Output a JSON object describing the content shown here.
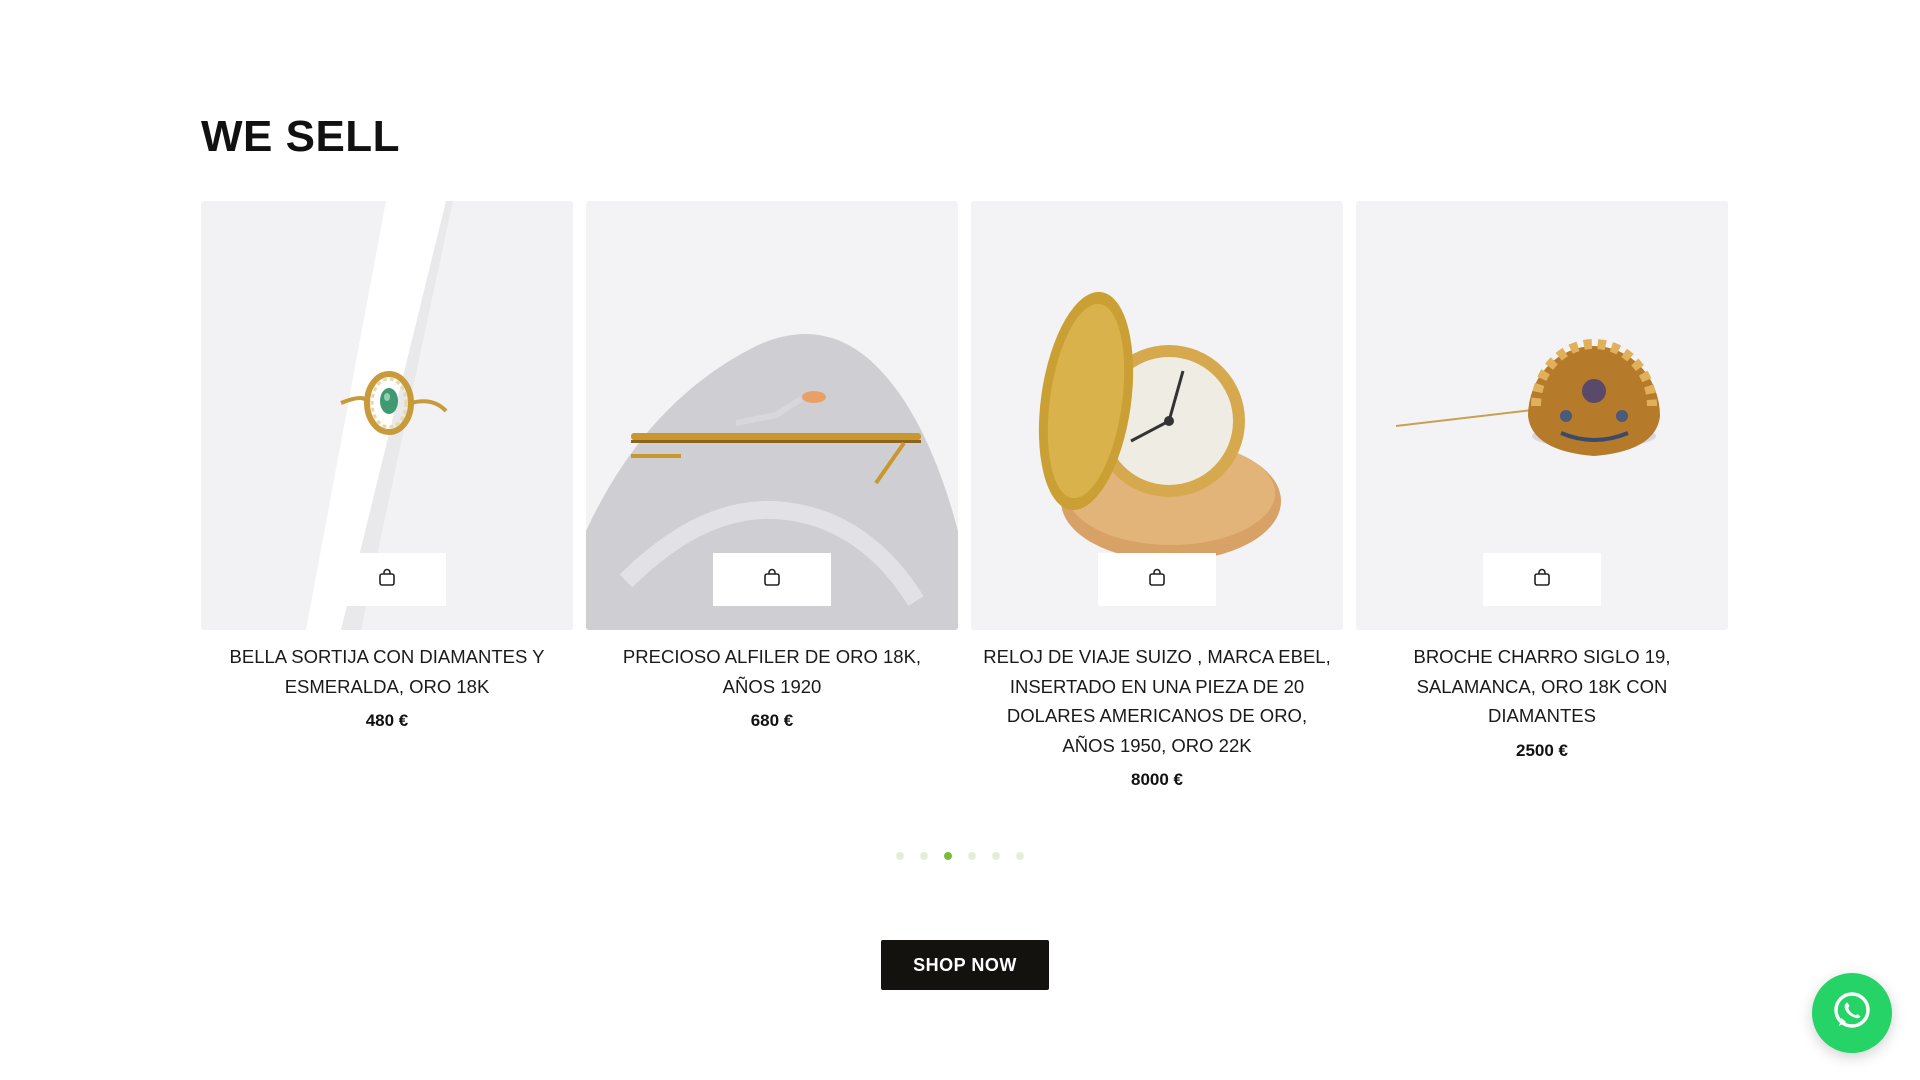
{
  "section": {
    "title": "WE SELL"
  },
  "products": [
    {
      "title": "BELLA SORTIJA CON DIAMANTES Y ESMERALDA, ORO 18K",
      "price": "480 €",
      "image": "emerald-ring-on-cone"
    },
    {
      "title": "PRECIOSO ALFILER DE ORO 18K, AÑOS 1920",
      "price": "680 €",
      "image": "gold-bar-brooch-on-velvet"
    },
    {
      "title": "RELOJ DE VIAJE SUIZO , MARCA EBEL, INSERTADO EN UNA PIEZA DE 20 DOLARES AMERICANOS DE ORO, AÑOS 1950, ORO 22K",
      "price": "8000 €",
      "image": "gold-coin-travel-watch"
    },
    {
      "title": "BROCHE CHARRO SIGLO 19, SALAMANCA, ORO 18K CON DIAMANTES",
      "price": "2500 €",
      "image": "charro-button-brooch"
    }
  ],
  "carousel": {
    "page_count": 6,
    "active_index": 2
  },
  "shop_button": {
    "label": "SHOP NOW"
  },
  "colors": {
    "accent_active_dot": "#7dbb3c",
    "inactive_dot": "#e5efd5",
    "button_bg": "#14120f",
    "whatsapp": "#25d366"
  },
  "icons": {
    "cart": "shopping-bag-icon",
    "chat": "whatsapp-icon"
  }
}
